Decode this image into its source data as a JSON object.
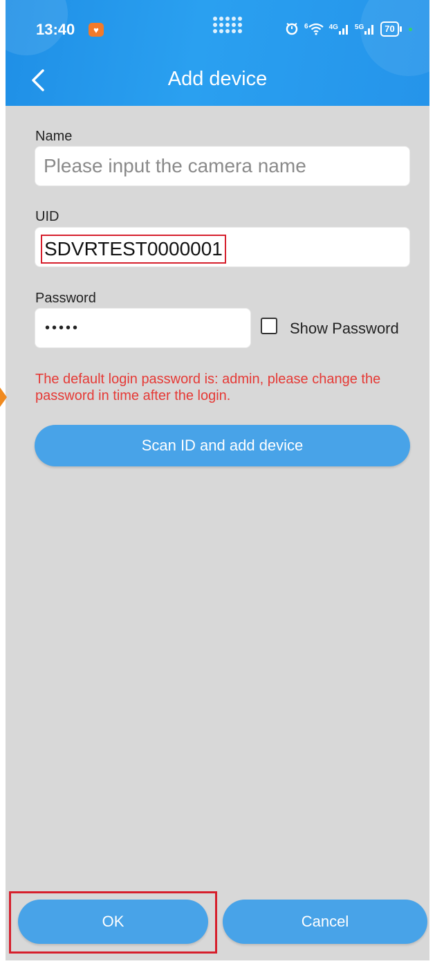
{
  "status_bar": {
    "time": "13:40",
    "app_icon": "heart-icon",
    "alarm_icon": "alarm-icon",
    "wifi_label": "6",
    "signal1_label": "4G",
    "signal2_label": "5G",
    "battery": "70"
  },
  "header": {
    "title": "Add device",
    "back_icon": "chevron-left-icon"
  },
  "form": {
    "name_label": "Name",
    "name_placeholder": "Please input the camera name",
    "uid_label": "UID",
    "uid_value": "SDVRTEST0000001",
    "password_label": "Password",
    "password_masked": "•••••",
    "show_password_label": "Show Password",
    "show_password_checked": false
  },
  "warning": "The default login password is: admin, please change the password in time after the login.",
  "buttons": {
    "scan": "Scan ID and add device",
    "ok": "OK",
    "cancel": "Cancel"
  },
  "colors": {
    "header": "#2594ea",
    "button": "#48a3e8",
    "warning": "#e53935",
    "highlight": "#d61f2c",
    "background": "#d8d8d8"
  }
}
